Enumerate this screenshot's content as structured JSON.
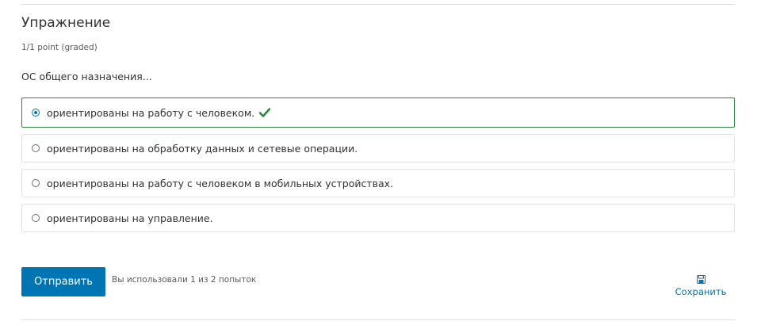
{
  "problem": {
    "title": "Упражнение",
    "points": "1/1 point (graded)",
    "question": "ОС общего назначения..."
  },
  "choices": [
    {
      "label": "ориентированы на работу с человеком.",
      "selected": true,
      "status": "correct"
    },
    {
      "label": "ориентированы на обработку данных и сетевые операции.",
      "selected": false
    },
    {
      "label": "ориентированы на работу с человеком в мобильных устройствах.",
      "selected": false
    },
    {
      "label": "ориентированы на управление.",
      "selected": false
    }
  ],
  "actions": {
    "submit_label": "Отправить",
    "attempts_text": "Вы использовали 1 из 2 попыток",
    "save_label": "Сохранить",
    "save_icon": "floppy-disk-icon"
  },
  "colors": {
    "accent": "#0075b4",
    "correct": "#2e8540",
    "border": "#e2e2e2"
  }
}
